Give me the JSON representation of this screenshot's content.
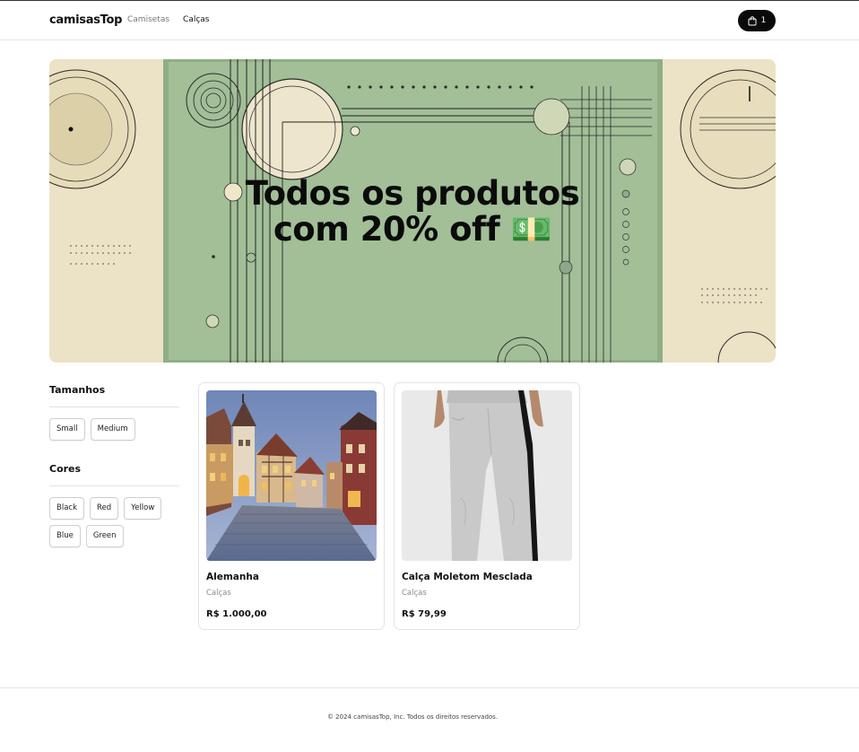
{
  "header": {
    "brand": "camisasTop",
    "nav": [
      {
        "label": "Camisetas",
        "active": false
      },
      {
        "label": "Calças",
        "active": true
      }
    ],
    "cart": {
      "icon": "shopping-bag-icon",
      "count": "1"
    }
  },
  "banner": {
    "line1": "Todos os produtos",
    "line2": "com 20% off 💵"
  },
  "filters": {
    "sizes_title": "Tamanhos",
    "sizes": [
      "Small",
      "Medium"
    ],
    "colors_title": "Cores",
    "colors": [
      "Black",
      "Red",
      "Yellow",
      "Blue",
      "Green"
    ]
  },
  "products": [
    {
      "name": "Alemanha",
      "category": "Calças",
      "price": "R$ 1.000,00"
    },
    {
      "name": "Calça Moletom Mesclada",
      "category": "Calças",
      "price": "R$ 79,99"
    }
  ],
  "footer": {
    "copyright": "© 2024 camisasTop, Inc. Todos os direitos reservados."
  }
}
